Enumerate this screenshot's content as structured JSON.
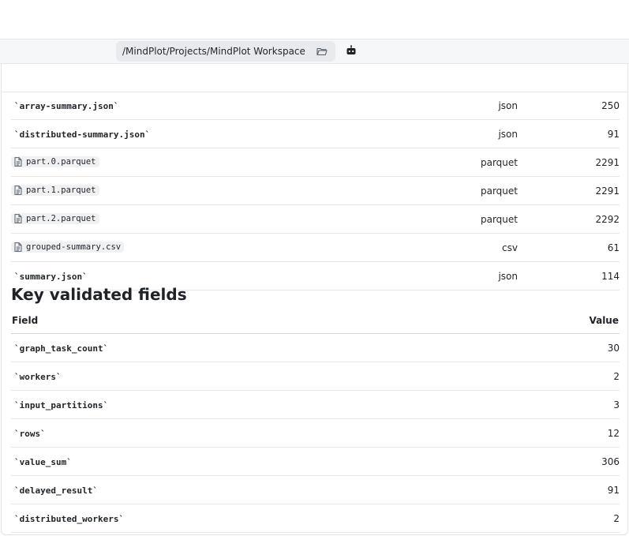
{
  "path_bar": {
    "path": "/MindPlot/Projects/MindPlot Workspace"
  },
  "files": [
    {
      "name": "`array-summary.json`",
      "kind": "code",
      "type": "json",
      "size": "250"
    },
    {
      "name": "`distributed-summary.json`",
      "kind": "code",
      "type": "json",
      "size": "91"
    },
    {
      "name": "part.0.parquet",
      "kind": "file",
      "type": "parquet",
      "size": "2291"
    },
    {
      "name": "part.1.parquet",
      "kind": "file",
      "type": "parquet",
      "size": "2291"
    },
    {
      "name": "part.2.parquet",
      "kind": "file",
      "type": "parquet",
      "size": "2292"
    },
    {
      "name": "grouped-summary.csv",
      "kind": "file",
      "type": "csv",
      "size": "61"
    },
    {
      "name": "`summary.json`",
      "kind": "code",
      "type": "json",
      "size": "114"
    }
  ],
  "fields_section": {
    "heading": "Key validated fields",
    "col_field": "Field",
    "col_value": "Value",
    "rows": [
      {
        "field": "`graph_task_count`",
        "value": "30"
      },
      {
        "field": "`workers`",
        "value": "2"
      },
      {
        "field": "`input_partitions`",
        "value": "3"
      },
      {
        "field": "`rows`",
        "value": "12"
      },
      {
        "field": "`value_sum`",
        "value": "306"
      },
      {
        "field": "`delayed_result`",
        "value": "91"
      },
      {
        "field": "`distributed_workers`",
        "value": "2"
      }
    ]
  }
}
